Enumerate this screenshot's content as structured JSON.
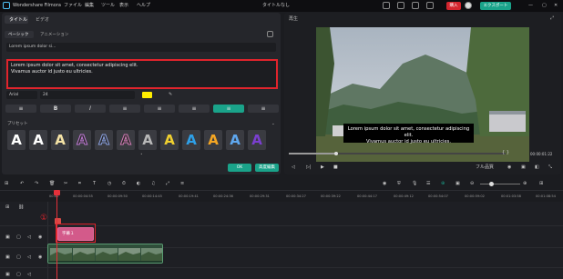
{
  "app": {
    "title": "Wondershare Filmora",
    "menu": [
      "ファイル",
      "編集",
      "ツール",
      "表示",
      "ヘルプ"
    ],
    "doc_title": "タイトルなし",
    "buy_label": "購入",
    "export_label": "エクスポート"
  },
  "left": {
    "tabs": [
      "タイトル",
      "ビデオ"
    ],
    "subtabs": [
      "ベーシック",
      "アニメーション"
    ],
    "field1": "Lorem ipsum dolor si...",
    "main_text_line1": "Lorem ipsum dolor sit amet, consectetur adipiscing elit.",
    "main_text_line2": "Vivamus auctor id justo eu ultricies.",
    "font": "Arial",
    "size": "24",
    "bold": "B",
    "italic": "I",
    "preset_label": "プリセット",
    "preset_letter": "A",
    "ok_label": "OK",
    "advanced_label": "高度編集",
    "marker": "①",
    "colors": {
      "accent": "#1aa38a",
      "highlight": "#e0242c",
      "text_color_swatch": "#ffee00"
    }
  },
  "preview": {
    "label": "再生",
    "subtitle_line1": "Lorem ipsum dolor sit amet, consectetur adipiscing elit.",
    "subtitle_line2": "Vivamus auctor id justo eu ultricies.",
    "timecode": "00:00:01:22",
    "quality": "フル品質",
    "brackets": "{     }"
  },
  "timeline": {
    "ticks": [
      "00:00",
      "00:00:04:55",
      "00:00:09:50",
      "00:00:14:45",
      "00:00:19:41",
      "00:00:24:36",
      "00:00:29:31",
      "00:00:34:27",
      "00:00:39:22",
      "00:00:44:17",
      "00:00:49:12",
      "00:00:54:07",
      "00:00:59:02",
      "00:01:03:58",
      "00:01:08:54"
    ],
    "title_clip_label": "字幕１",
    "marker": "①"
  }
}
